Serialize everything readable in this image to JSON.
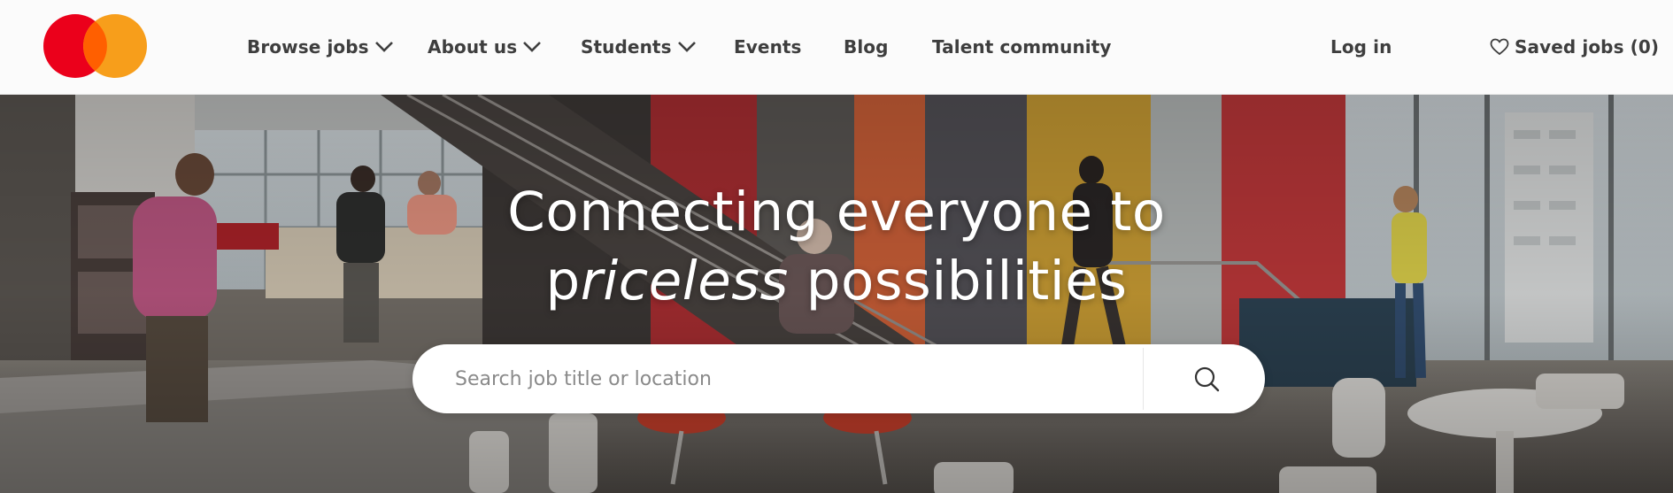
{
  "brand": {
    "logo_icon": "mastercard-logo",
    "red": "#eb001b",
    "orange": "#f79e1b",
    "overlap": "#ff5f00"
  },
  "nav": {
    "browse_jobs": "Browse jobs",
    "about_us": "About us",
    "students": "Students",
    "events": "Events",
    "blog": "Blog",
    "talent_community": "Talent community",
    "log_in": "Log in",
    "saved_jobs": "Saved jobs (0)"
  },
  "hero": {
    "headline_line1": "Connecting everyone to",
    "headline_p": "p",
    "headline_italic": "riceless",
    "headline_rest": " possibilities",
    "image": "office-atrium-photo"
  },
  "search": {
    "placeholder": "Search job title or location",
    "value": "",
    "icon": "search-icon"
  }
}
